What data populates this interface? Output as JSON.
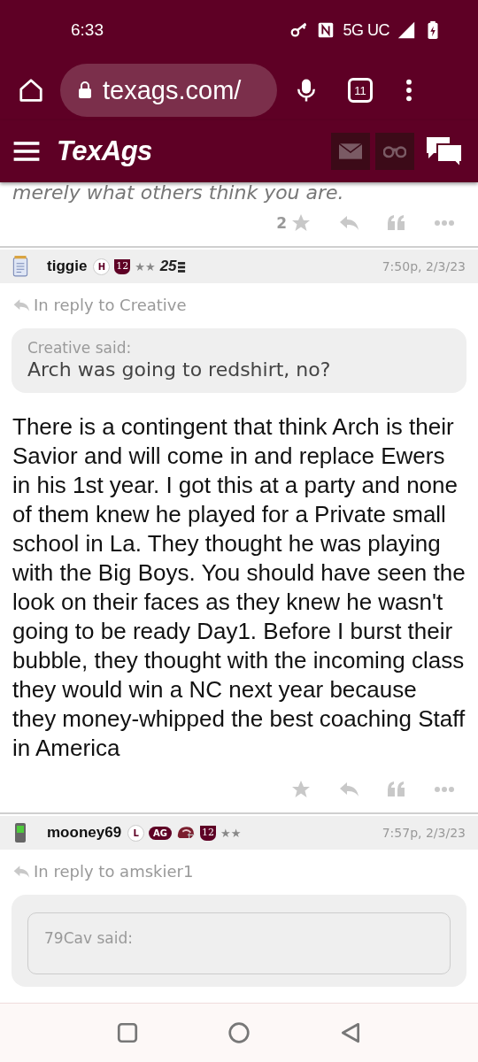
{
  "status_bar": {
    "time": "6:33",
    "network": "5G UC"
  },
  "browser": {
    "url": "texags.com/",
    "tab_count": "11"
  },
  "site_header": {
    "logo": "TexAgs"
  },
  "posts": [
    {
      "kind": "tail",
      "text": "merely what others think you are.",
      "star_count": "2"
    },
    {
      "kind": "full",
      "device": {
        "kind": "notepad"
      },
      "user": "tiggie",
      "badges": [
        {
          "kind": "circle",
          "text": "H"
        },
        {
          "kind": "shield",
          "text": "12"
        },
        {
          "kind": "stars",
          "text": "★★"
        },
        {
          "kind": "rank",
          "text": "25"
        }
      ],
      "time": "7:50p, 2/3/23",
      "reply_to": "In reply to Creative",
      "quote": {
        "author": "Creative said:",
        "text": "Arch was going to redshirt, no?"
      },
      "body": "There is a contingent that think Arch is their Savior and will come in and replace Ewers in his 1st year. I got this at a party and none of them knew he played for a Private small school in La. They thought he was playing with the Big Boys. You should have seen the look on their faces as they knew he wasn't going to be ready Day1. Before I burst their bubble, they thought with the incoming class they would win a NC next year because they money-whipped the best coaching Staff in America"
    },
    {
      "kind": "partial",
      "device": {
        "kind": "phone"
      },
      "user": "mooney69",
      "badges": [
        {
          "kind": "circle",
          "text": "L"
        },
        {
          "kind": "pill",
          "text": "AG"
        },
        {
          "kind": "helmet"
        },
        {
          "kind": "shield",
          "text": "12"
        },
        {
          "kind": "stars",
          "text": "★★"
        }
      ],
      "time": "7:57p, 2/3/23",
      "reply_to": "In reply to amskier1",
      "nested_quote_author": "79Cav said:"
    }
  ]
}
